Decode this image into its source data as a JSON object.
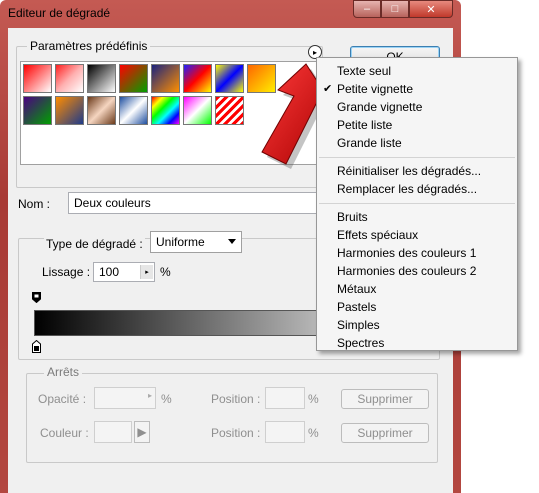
{
  "window": {
    "title": "Editeur de dégradé",
    "controls": {
      "minimize": "–",
      "maximize": "□",
      "close": "✕"
    }
  },
  "presets": {
    "label": "Paramètres prédéfinis",
    "menu_button_icon": "▸",
    "swatches": [
      "linear-gradient(135deg,#ff0000,#ffffff)",
      "linear-gradient(135deg,#ff2020 0%,#ffb0b0 50%,#ffffff 100%)",
      "linear-gradient(135deg,#000000,#ffffff)",
      "linear-gradient(135deg,#ff0000,#00a000)",
      "linear-gradient(135deg,#1a237e,#ff8f00)",
      "linear-gradient(135deg,#2020ff,#ff0000,#ffff00)",
      "linear-gradient(135deg,#ffff00,#0000ff,#ffff00)",
      "linear-gradient(135deg,#ff6600,#ffee00)",
      "linear-gradient(135deg,#4b0082,#00a000)",
      "linear-gradient(135deg,#ff8c00,#1e3a8a)",
      "linear-gradient(135deg,#6b3a1a,#f5d5c0,#6b3a1a)",
      "linear-gradient(135deg,#1f4fa0,#ffffff,#1f4fa0)",
      "linear-gradient(135deg,#ff0000,#ffff00,#00ff00,#00ffff,#0000ff,#ff00ff)",
      "linear-gradient(135deg,#ff00ff,#ffffff,#00ff00)",
      "repeating-linear-gradient(135deg,#ff0000 0 3px,#ffffff 3px 6px)"
    ]
  },
  "buttons": {
    "ok": "OK"
  },
  "name": {
    "label": "Nom :",
    "value": "Deux couleurs"
  },
  "gradient_type": {
    "label": "Type de dégradé :",
    "value": "Uniforme"
  },
  "smoothness": {
    "label": "Lissage :",
    "value": "100",
    "unit": "%"
  },
  "stops": {
    "title": "Arrêts",
    "opacity_label": "Opacité :",
    "opacity_unit": "%",
    "color_label": "Couleur :",
    "position_label": "Position :",
    "position_unit": "%",
    "delete_label": "Supprimer"
  },
  "context_menu": {
    "group1": [
      {
        "label": "Texte seul",
        "checked": false
      },
      {
        "label": "Petite vignette",
        "checked": true
      },
      {
        "label": "Grande vignette",
        "checked": false
      },
      {
        "label": "Petite liste",
        "checked": false
      },
      {
        "label": "Grande liste",
        "checked": false
      }
    ],
    "group2": [
      {
        "label": "Réinitialiser les dégradés..."
      },
      {
        "label": "Remplacer les dégradés..."
      }
    ],
    "group3": [
      {
        "label": "Bruits"
      },
      {
        "label": "Effets spéciaux"
      },
      {
        "label": "Harmonies des couleurs 1"
      },
      {
        "label": "Harmonies des couleurs 2"
      },
      {
        "label": "Métaux"
      },
      {
        "label": "Pastels"
      },
      {
        "label": "Simples"
      },
      {
        "label": "Spectres"
      }
    ],
    "check_mark": "✔"
  },
  "colors": {
    "frame": "#b9463f",
    "client": "#f0f0f0",
    "arrow": "#d10000"
  }
}
